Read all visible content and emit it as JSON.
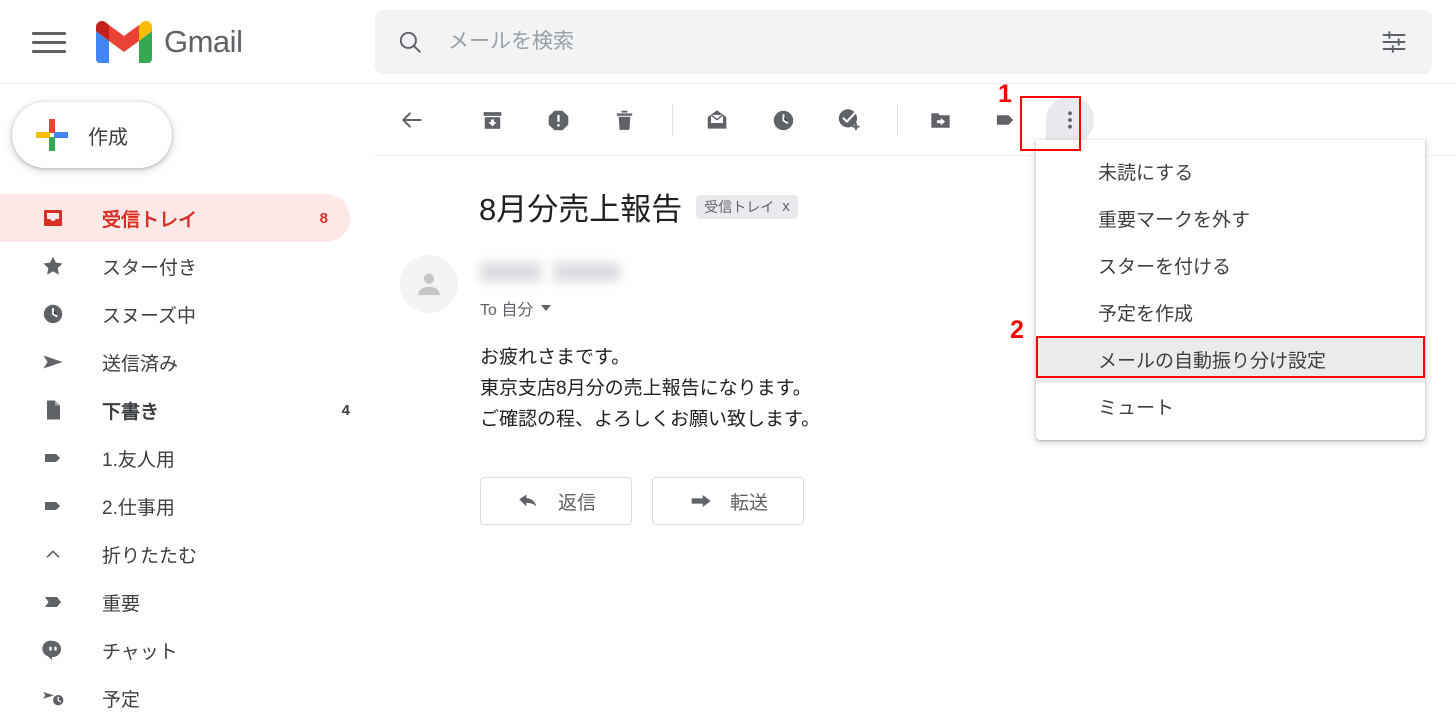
{
  "header": {
    "menu_icon": "hamburger-icon",
    "brand": "Gmail",
    "logo_icon": "gmail-logo-icon"
  },
  "search": {
    "placeholder": "メールを検索",
    "value": "",
    "icon": "search-icon",
    "options_icon": "search-options-icon"
  },
  "sidebar": {
    "compose": {
      "label": "作成",
      "icon": "plus-icon"
    },
    "items": [
      {
        "label": "受信トレイ",
        "count": "8",
        "icon": "inbox-icon",
        "active": true
      },
      {
        "label": "スター付き",
        "count": "",
        "icon": "star-icon",
        "active": false
      },
      {
        "label": "スヌーズ中",
        "count": "",
        "icon": "clock-icon",
        "active": false
      },
      {
        "label": "送信済み",
        "count": "",
        "icon": "send-icon",
        "active": false
      },
      {
        "label": "下書き",
        "count": "4",
        "icon": "draft-icon",
        "active": false
      },
      {
        "label": "1.友人用",
        "count": "",
        "icon": "label-icon",
        "active": false
      },
      {
        "label": "2.仕事用",
        "count": "",
        "icon": "label-icon",
        "active": false
      },
      {
        "label": "折りたたむ",
        "count": "",
        "icon": "chevron-up-icon",
        "active": false
      },
      {
        "label": "重要",
        "count": "",
        "icon": "important-icon",
        "active": false
      },
      {
        "label": "チャット",
        "count": "",
        "icon": "chat-icon",
        "active": false
      },
      {
        "label": "予定",
        "count": "",
        "icon": "scheduled-icon",
        "active": false
      }
    ]
  },
  "toolbar": {
    "buttons": [
      {
        "name": "back-button",
        "icon": "arrow-left-icon"
      },
      {
        "name": "archive-button",
        "icon": "archive-icon"
      },
      {
        "name": "report-spam-button",
        "icon": "report-spam-icon"
      },
      {
        "name": "delete-button",
        "icon": "trash-icon"
      },
      {
        "name": "mark-unread-button",
        "icon": "mark-unread-icon"
      },
      {
        "name": "snooze-button",
        "icon": "clock-icon"
      },
      {
        "name": "add-to-tasks-button",
        "icon": "add-task-icon"
      },
      {
        "name": "move-to-button",
        "icon": "move-to-folder-icon"
      },
      {
        "name": "labels-button",
        "icon": "label-icon"
      },
      {
        "name": "more-button",
        "icon": "more-vertical-icon"
      }
    ]
  },
  "email": {
    "subject": "8月分売上報告",
    "label_chip": "受信トレイ",
    "label_chip_remove": "x",
    "to_line": "To 自分",
    "body": "お疲れさまです。\n東京支店8月分の売上報告になります。\nご確認の程、よろしくお願い致します。",
    "reply_button": "返信",
    "forward_button": "転送",
    "reply_icon": "reply-arrow-icon",
    "forward_icon": "forward-arrow-icon",
    "avatar_icon": "person-avatar-icon"
  },
  "more_menu": {
    "items": [
      {
        "label": "未読にする",
        "highlighted": false
      },
      {
        "label": "重要マークを外す",
        "highlighted": false
      },
      {
        "label": "スターを付ける",
        "highlighted": false
      },
      {
        "label": "予定を作成",
        "highlighted": false
      },
      {
        "label": "メールの自動振り分け設定",
        "highlighted": true
      },
      {
        "label": "ミュート",
        "highlighted": false
      }
    ]
  },
  "annotations": {
    "step_one": "1",
    "step_two": "2",
    "color": "#ff0000"
  },
  "colors": {
    "accent_red": "#d93025",
    "active_bg": "#fce8e6",
    "search_bg": "#f1f3f4",
    "text_primary": "#202124",
    "text_secondary": "#5f6368"
  }
}
